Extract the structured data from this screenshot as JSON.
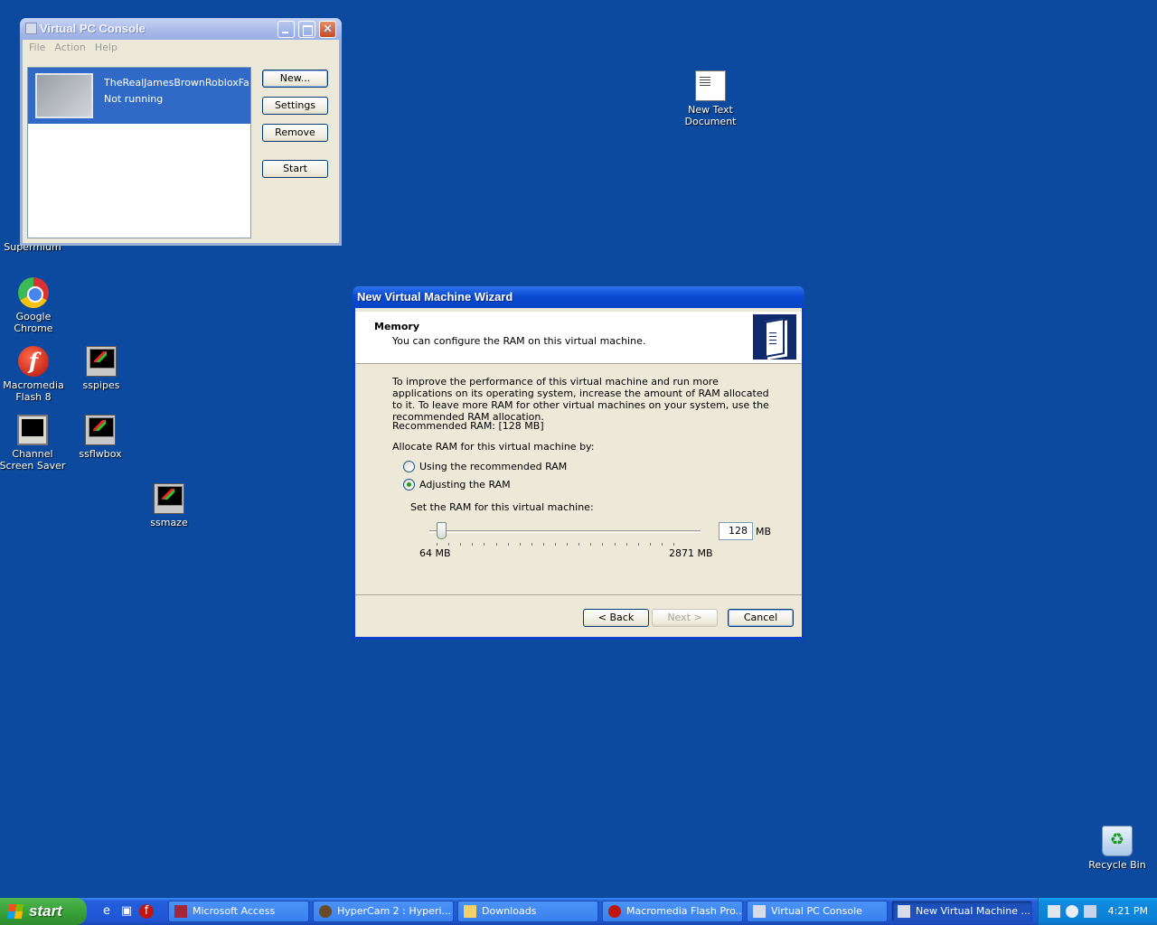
{
  "desktop": {
    "icons": [
      {
        "label": "Google Chrome",
        "icon": "chrome-icon"
      },
      {
        "label": "Macromedia Flash 8",
        "icon": "flash-icon"
      },
      {
        "label": "sspipes",
        "icon": "screensaver-icon"
      },
      {
        "label": "Channel Screen Saver",
        "icon": "monitor-icon"
      },
      {
        "label": "ssflwbox",
        "icon": "screensaver-icon"
      },
      {
        "label": "ssmaze",
        "icon": "screensaver-icon"
      },
      {
        "label": "New Text Document",
        "icon": "text-document-icon"
      },
      {
        "label": "Recycle Bin",
        "icon": "recycle-bin-icon"
      }
    ],
    "partial_label": "Supermium"
  },
  "vpc_console": {
    "title": "Virtual PC Console",
    "menu": [
      "File",
      "Action",
      "Help"
    ],
    "vm": {
      "name": "TheRealJamesBrownRobloxFan…",
      "status": "Not running"
    },
    "buttons": {
      "new": "New...",
      "settings": "Settings",
      "remove": "Remove",
      "start": "Start"
    },
    "close_glyph": "✕"
  },
  "wizard": {
    "title": "New Virtual Machine Wizard",
    "header_title": "Memory",
    "header_subtitle": "You can configure the RAM on this virtual machine.",
    "intro": "To improve the performance of this virtual machine and run more applications on its operating system, increase the amount of RAM allocated to it. To leave more RAM for other virtual machines on your system, use the recommended RAM allocation.",
    "recommended": "Recommended RAM: [128 MB]",
    "allocate_label": "Allocate RAM for this virtual machine by:",
    "option_recommended": "Using the recommended RAM",
    "option_adjusting": "Adjusting the RAM",
    "selected_option": "adjusting",
    "set_label": "Set the RAM for this virtual machine:",
    "slider": {
      "min_label": "64 MB",
      "max_label": "2871 MB",
      "min_mb": 64,
      "max_mb": 2871,
      "value_mb": 128
    },
    "ram_value": "128",
    "ram_unit": "MB",
    "buttons": {
      "back": "< Back",
      "next": "Next >",
      "cancel": "Cancel"
    }
  },
  "taskbar": {
    "start_label": "start",
    "tasks": [
      {
        "label": "Microsoft Access",
        "icon": "access-icon"
      },
      {
        "label": "HyperCam 2 : Hyperi...",
        "icon": "hypercam-icon"
      },
      {
        "label": "Downloads",
        "icon": "folder-icon"
      },
      {
        "label": "Macromedia Flash Pro...",
        "icon": "flash-icon"
      },
      {
        "label": "Virtual PC Console",
        "icon": "virtual-pc-icon"
      },
      {
        "label": "New Virtual Machine ...",
        "icon": "virtual-pc-icon"
      }
    ],
    "clock": "4:21 PM"
  }
}
